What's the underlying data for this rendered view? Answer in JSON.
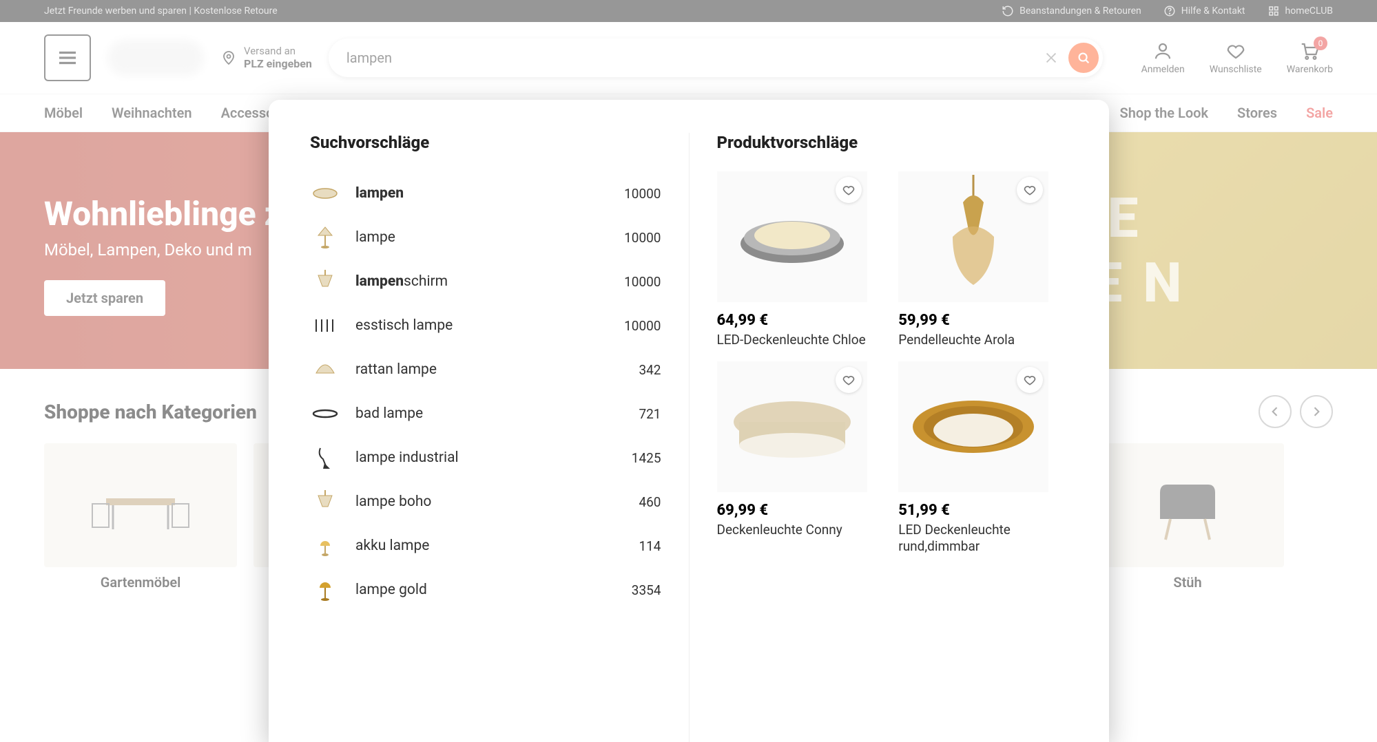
{
  "topbar": {
    "promo": "Jetzt Freunde werben und sparen | Kostenlose Retoure",
    "returns": "Beanstandungen & Retouren",
    "help": "Hilfe & Kontakt",
    "club": "homeCLUB"
  },
  "header": {
    "shipto_label": "Versand an",
    "shipto_value": "PLZ eingeben",
    "search_value": "lampen",
    "login": "Anmelden",
    "wishlist": "Wunschliste",
    "cart": "Warenkorb",
    "cart_count": "0"
  },
  "nav": {
    "items": [
      "Möbel",
      "Weihnachten",
      "Accessoires",
      "Shop the Look",
      "Stores",
      "Sale"
    ]
  },
  "hero": {
    "title": "Wohnlieblinge z",
    "subtitle": "Möbel, Lampen, Deko und m",
    "cta": "Jetzt sparen",
    "banner_line1": "R E",
    "banner_line2": "ONEN"
  },
  "categories": {
    "title": "Shoppe nach Kategorien",
    "tiles": [
      {
        "label": "Gartenmöbel"
      },
      {
        "label": ""
      },
      {
        "label": ""
      },
      {
        "label": ""
      },
      {
        "label": ""
      },
      {
        "label": "Stüh"
      }
    ]
  },
  "flyout": {
    "suggestions_title": "Suchvorschläge",
    "products_title": "Produktvorschläge",
    "suggestions": [
      {
        "prefix": "lampen",
        "suffix": "",
        "count": "10000"
      },
      {
        "prefix": "",
        "suffix": "lampe",
        "count": "10000"
      },
      {
        "prefix": "lampen",
        "suffix": "schirm",
        "count": "10000"
      },
      {
        "prefix": "",
        "suffix": "esstisch lampe",
        "count": "10000"
      },
      {
        "prefix": "",
        "suffix": "rattan lampe",
        "count": "342"
      },
      {
        "prefix": "",
        "suffix": "bad lampe",
        "count": "721"
      },
      {
        "prefix": "",
        "suffix": "lampe industrial",
        "count": "1425"
      },
      {
        "prefix": "",
        "suffix": "lampe boho",
        "count": "460"
      },
      {
        "prefix": "",
        "suffix": "akku lampe",
        "count": "114"
      },
      {
        "prefix": "",
        "suffix": "lampe gold",
        "count": "3354"
      }
    ],
    "products": [
      {
        "price": "64,99 €",
        "name": "LED-Deckenleuchte Chloe"
      },
      {
        "price": "59,99 €",
        "name": "Pendelleuchte Arola"
      },
      {
        "price": "69,99 €",
        "name": "Deckenleuchte Conny"
      },
      {
        "price": "51,99 €",
        "name": "LED Deckenleuchte rund,dimmbar"
      }
    ]
  }
}
